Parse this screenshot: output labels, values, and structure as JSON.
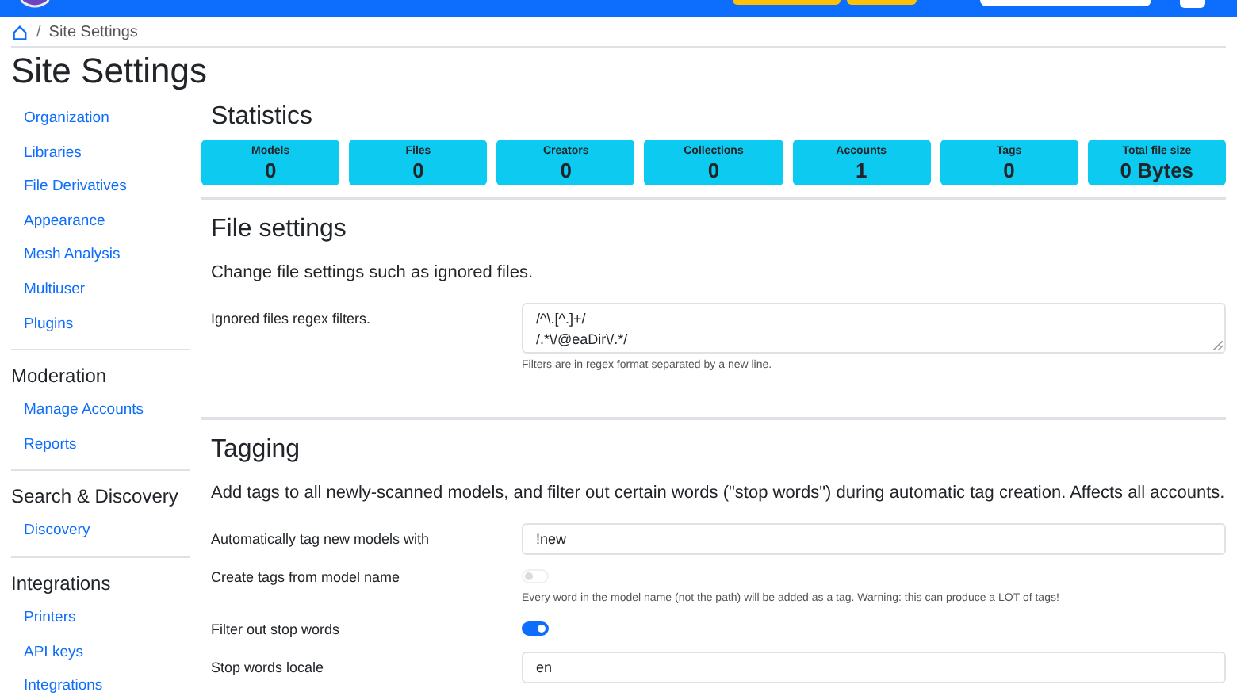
{
  "breadcrumb": {
    "separator": "/",
    "current": "Site Settings"
  },
  "page_title": "Site Settings",
  "sidebar": {
    "groups": [
      {
        "items": [
          "Organization",
          "Libraries",
          "File Derivatives",
          "Appearance",
          "Mesh Analysis",
          "Multiuser",
          "Plugins"
        ]
      },
      {
        "heading": "Moderation",
        "items": [
          "Manage Accounts",
          "Reports"
        ]
      },
      {
        "heading": "Search & Discovery",
        "items": [
          "Discovery"
        ]
      },
      {
        "heading": "Integrations",
        "items": [
          "Printers",
          "API keys",
          "Integrations"
        ]
      }
    ]
  },
  "statistics": {
    "title": "Statistics",
    "cards": [
      {
        "label": "Models",
        "value": "0"
      },
      {
        "label": "Files",
        "value": "0"
      },
      {
        "label": "Creators",
        "value": "0"
      },
      {
        "label": "Collections",
        "value": "0"
      },
      {
        "label": "Accounts",
        "value": "1"
      },
      {
        "label": "Tags",
        "value": "0"
      },
      {
        "label": "Total file size",
        "value": "0 Bytes"
      }
    ]
  },
  "sections": [
    {
      "title": "File settings",
      "description": "Change file settings such as ignored files.",
      "rows": [
        {
          "kind": "textarea",
          "label": "Ignored files regex filters.",
          "lines": [
            "/^\\.[^.]+/",
            "/.*\\/@eaDir\\/.*/"
          ],
          "help": "Filters are in regex format separated by a new line."
        }
      ]
    },
    {
      "title": "Tagging",
      "description": "Add tags to all newly-scanned models, and filter out certain words (\"stop words\") during automatic tag creation. Affects all accounts.",
      "rows": [
        {
          "kind": "input",
          "label": "Automatically tag new models with",
          "value": "!new"
        },
        {
          "kind": "switch",
          "label": "Create tags from model name",
          "checked": false,
          "disabled": true,
          "help": "Every word in the model name (not the path) will be added as a tag. Warning: this can produce a LOT of tags!"
        },
        {
          "kind": "switch",
          "label": "Filter out stop words",
          "checked": true,
          "disabled": false
        },
        {
          "kind": "input",
          "label": "Stop words locale",
          "value": "en"
        }
      ]
    }
  ]
}
